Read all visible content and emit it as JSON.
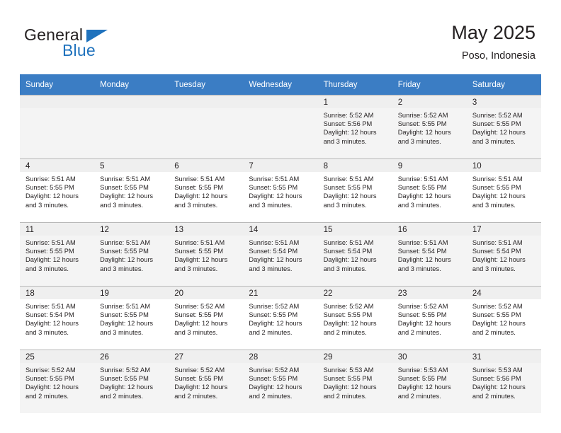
{
  "brand": {
    "name_primary": "General",
    "name_secondary": "Blue",
    "logo_icon": "blue-triangle-icon",
    "accent_color": "#1f72bd"
  },
  "header": {
    "title": "May 2025",
    "subtitle": "Poso, Indonesia"
  },
  "theme": {
    "header_bar_color": "#3b7dc4",
    "header_text_color": "#ffffff",
    "daynum_band_color": "#efefef",
    "row_shade_color": "#f4f4f4",
    "grid_line_color": "#b9b9b9",
    "text_color": "#231f20"
  },
  "calendar": {
    "weekday_headers": [
      "Sunday",
      "Monday",
      "Tuesday",
      "Wednesday",
      "Thursday",
      "Friday",
      "Saturday"
    ],
    "labels": {
      "sunrise_prefix": "Sunrise:",
      "sunset_prefix": "Sunset:",
      "daylight_prefix": "Daylight:"
    },
    "weeks": [
      [
        {
          "day": "",
          "empty": true
        },
        {
          "day": "",
          "empty": true
        },
        {
          "day": "",
          "empty": true
        },
        {
          "day": "",
          "empty": true
        },
        {
          "day": "1",
          "sunrise": "Sunrise: 5:52 AM",
          "sunset": "Sunset: 5:56 PM",
          "daylight_line1": "Daylight: 12 hours",
          "daylight_line2": "and 3 minutes."
        },
        {
          "day": "2",
          "sunrise": "Sunrise: 5:52 AM",
          "sunset": "Sunset: 5:55 PM",
          "daylight_line1": "Daylight: 12 hours",
          "daylight_line2": "and 3 minutes."
        },
        {
          "day": "3",
          "sunrise": "Sunrise: 5:52 AM",
          "sunset": "Sunset: 5:55 PM",
          "daylight_line1": "Daylight: 12 hours",
          "daylight_line2": "and 3 minutes."
        }
      ],
      [
        {
          "day": "4",
          "sunrise": "Sunrise: 5:51 AM",
          "sunset": "Sunset: 5:55 PM",
          "daylight_line1": "Daylight: 12 hours",
          "daylight_line2": "and 3 minutes."
        },
        {
          "day": "5",
          "sunrise": "Sunrise: 5:51 AM",
          "sunset": "Sunset: 5:55 PM",
          "daylight_line1": "Daylight: 12 hours",
          "daylight_line2": "and 3 minutes."
        },
        {
          "day": "6",
          "sunrise": "Sunrise: 5:51 AM",
          "sunset": "Sunset: 5:55 PM",
          "daylight_line1": "Daylight: 12 hours",
          "daylight_line2": "and 3 minutes."
        },
        {
          "day": "7",
          "sunrise": "Sunrise: 5:51 AM",
          "sunset": "Sunset: 5:55 PM",
          "daylight_line1": "Daylight: 12 hours",
          "daylight_line2": "and 3 minutes."
        },
        {
          "day": "8",
          "sunrise": "Sunrise: 5:51 AM",
          "sunset": "Sunset: 5:55 PM",
          "daylight_line1": "Daylight: 12 hours",
          "daylight_line2": "and 3 minutes."
        },
        {
          "day": "9",
          "sunrise": "Sunrise: 5:51 AM",
          "sunset": "Sunset: 5:55 PM",
          "daylight_line1": "Daylight: 12 hours",
          "daylight_line2": "and 3 minutes."
        },
        {
          "day": "10",
          "sunrise": "Sunrise: 5:51 AM",
          "sunset": "Sunset: 5:55 PM",
          "daylight_line1": "Daylight: 12 hours",
          "daylight_line2": "and 3 minutes."
        }
      ],
      [
        {
          "day": "11",
          "sunrise": "Sunrise: 5:51 AM",
          "sunset": "Sunset: 5:55 PM",
          "daylight_line1": "Daylight: 12 hours",
          "daylight_line2": "and 3 minutes."
        },
        {
          "day": "12",
          "sunrise": "Sunrise: 5:51 AM",
          "sunset": "Sunset: 5:55 PM",
          "daylight_line1": "Daylight: 12 hours",
          "daylight_line2": "and 3 minutes."
        },
        {
          "day": "13",
          "sunrise": "Sunrise: 5:51 AM",
          "sunset": "Sunset: 5:55 PM",
          "daylight_line1": "Daylight: 12 hours",
          "daylight_line2": "and 3 minutes."
        },
        {
          "day": "14",
          "sunrise": "Sunrise: 5:51 AM",
          "sunset": "Sunset: 5:54 PM",
          "daylight_line1": "Daylight: 12 hours",
          "daylight_line2": "and 3 minutes."
        },
        {
          "day": "15",
          "sunrise": "Sunrise: 5:51 AM",
          "sunset": "Sunset: 5:54 PM",
          "daylight_line1": "Daylight: 12 hours",
          "daylight_line2": "and 3 minutes."
        },
        {
          "day": "16",
          "sunrise": "Sunrise: 5:51 AM",
          "sunset": "Sunset: 5:54 PM",
          "daylight_line1": "Daylight: 12 hours",
          "daylight_line2": "and 3 minutes."
        },
        {
          "day": "17",
          "sunrise": "Sunrise: 5:51 AM",
          "sunset": "Sunset: 5:54 PM",
          "daylight_line1": "Daylight: 12 hours",
          "daylight_line2": "and 3 minutes."
        }
      ],
      [
        {
          "day": "18",
          "sunrise": "Sunrise: 5:51 AM",
          "sunset": "Sunset: 5:54 PM",
          "daylight_line1": "Daylight: 12 hours",
          "daylight_line2": "and 3 minutes."
        },
        {
          "day": "19",
          "sunrise": "Sunrise: 5:51 AM",
          "sunset": "Sunset: 5:55 PM",
          "daylight_line1": "Daylight: 12 hours",
          "daylight_line2": "and 3 minutes."
        },
        {
          "day": "20",
          "sunrise": "Sunrise: 5:52 AM",
          "sunset": "Sunset: 5:55 PM",
          "daylight_line1": "Daylight: 12 hours",
          "daylight_line2": "and 3 minutes."
        },
        {
          "day": "21",
          "sunrise": "Sunrise: 5:52 AM",
          "sunset": "Sunset: 5:55 PM",
          "daylight_line1": "Daylight: 12 hours",
          "daylight_line2": "and 2 minutes."
        },
        {
          "day": "22",
          "sunrise": "Sunrise: 5:52 AM",
          "sunset": "Sunset: 5:55 PM",
          "daylight_line1": "Daylight: 12 hours",
          "daylight_line2": "and 2 minutes."
        },
        {
          "day": "23",
          "sunrise": "Sunrise: 5:52 AM",
          "sunset": "Sunset: 5:55 PM",
          "daylight_line1": "Daylight: 12 hours",
          "daylight_line2": "and 2 minutes."
        },
        {
          "day": "24",
          "sunrise": "Sunrise: 5:52 AM",
          "sunset": "Sunset: 5:55 PM",
          "daylight_line1": "Daylight: 12 hours",
          "daylight_line2": "and 2 minutes."
        }
      ],
      [
        {
          "day": "25",
          "sunrise": "Sunrise: 5:52 AM",
          "sunset": "Sunset: 5:55 PM",
          "daylight_line1": "Daylight: 12 hours",
          "daylight_line2": "and 2 minutes."
        },
        {
          "day": "26",
          "sunrise": "Sunrise: 5:52 AM",
          "sunset": "Sunset: 5:55 PM",
          "daylight_line1": "Daylight: 12 hours",
          "daylight_line2": "and 2 minutes."
        },
        {
          "day": "27",
          "sunrise": "Sunrise: 5:52 AM",
          "sunset": "Sunset: 5:55 PM",
          "daylight_line1": "Daylight: 12 hours",
          "daylight_line2": "and 2 minutes."
        },
        {
          "day": "28",
          "sunrise": "Sunrise: 5:52 AM",
          "sunset": "Sunset: 5:55 PM",
          "daylight_line1": "Daylight: 12 hours",
          "daylight_line2": "and 2 minutes."
        },
        {
          "day": "29",
          "sunrise": "Sunrise: 5:53 AM",
          "sunset": "Sunset: 5:55 PM",
          "daylight_line1": "Daylight: 12 hours",
          "daylight_line2": "and 2 minutes."
        },
        {
          "day": "30",
          "sunrise": "Sunrise: 5:53 AM",
          "sunset": "Sunset: 5:55 PM",
          "daylight_line1": "Daylight: 12 hours",
          "daylight_line2": "and 2 minutes."
        },
        {
          "day": "31",
          "sunrise": "Sunrise: 5:53 AM",
          "sunset": "Sunset: 5:56 PM",
          "daylight_line1": "Daylight: 12 hours",
          "daylight_line2": "and 2 minutes."
        }
      ]
    ]
  }
}
